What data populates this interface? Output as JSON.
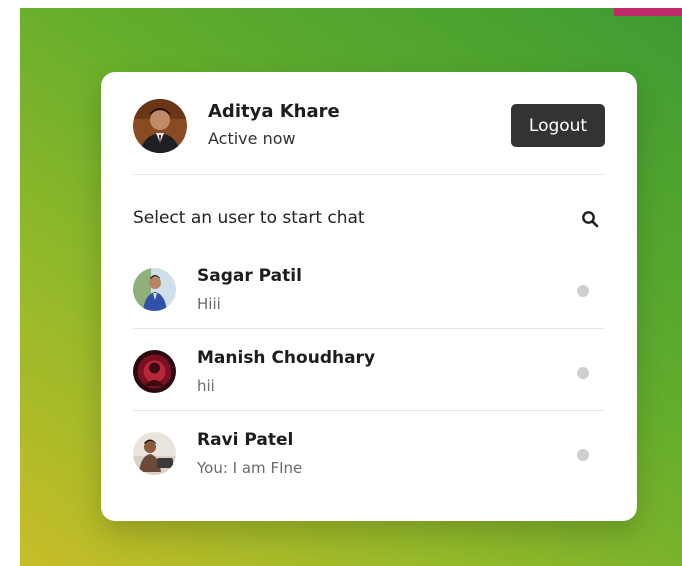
{
  "current_user": {
    "name": "Aditya Khare",
    "status": "Active now",
    "avatar_icon": "user-avatar-photo"
  },
  "header": {
    "logout_label": "Logout"
  },
  "search": {
    "prompt": "Select an user to start chat",
    "icon": "search-icon"
  },
  "users": [
    {
      "name": "Sagar Patil",
      "last_message": "Hiii",
      "status": "offline"
    },
    {
      "name": "Manish Choudhary",
      "last_message": "hii",
      "status": "offline"
    },
    {
      "name": "Ravi Patel",
      "last_message": "You: I am FIne",
      "status": "offline"
    }
  ],
  "colors": {
    "background_gradient_start": "#3e9b32",
    "background_gradient_end": "#c7bd27",
    "logout_button": "#333333",
    "offline_dot": "#cfcfcf",
    "accent_corner": "#c02c6a"
  }
}
